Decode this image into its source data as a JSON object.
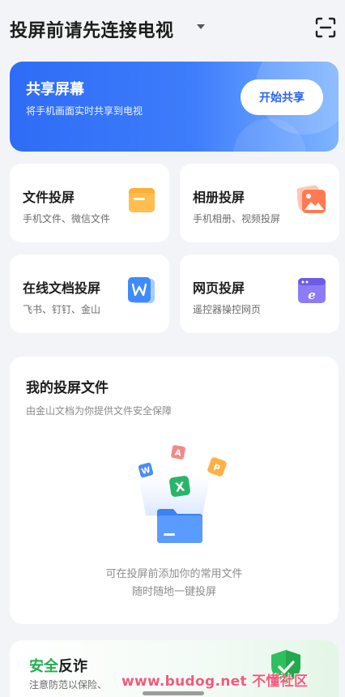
{
  "header": {
    "title": "投屏前请先连接电视"
  },
  "share": {
    "title": "共享屏幕",
    "subtitle": "将手机画面实时共享到电视",
    "button": "开始共享"
  },
  "cards": [
    {
      "title": "文件投屏",
      "subtitle": "手机文件、微信文件",
      "icon": "folder-icon"
    },
    {
      "title": "相册投屏",
      "subtitle": "手机相册、视频投屏",
      "icon": "photo-icon"
    },
    {
      "title": "在线文档投屏",
      "subtitle": "飞书、钉钉、金山",
      "icon": "document-icon"
    },
    {
      "title": "网页投屏",
      "subtitle": "遥控器操控网页",
      "icon": "browser-icon"
    }
  ],
  "files": {
    "title": "我的投屏文件",
    "subtitle": "由金山文档为你提供文件安全保障",
    "empty_line1": "可在投屏前添加你的常用文件",
    "empty_line2": "随时随地一键投屏"
  },
  "security": {
    "title_green": "安全",
    "title_black": "反诈",
    "subtitle": "注意防范以保险、"
  },
  "watermark": "www.budog.net 不懂社区",
  "colors": {
    "accent_blue": "#2f6cf6",
    "safe_green": "#1fae4b",
    "background": "#f3f4f7"
  }
}
